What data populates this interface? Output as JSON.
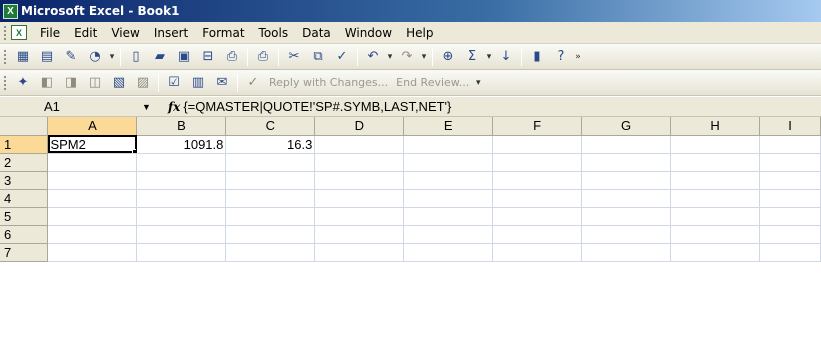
{
  "window": {
    "title": "Microsoft Excel - Book1",
    "app_icon": "X",
    "accent": "#0a246a"
  },
  "menu": {
    "doc_icon": "X",
    "items": [
      "File",
      "Edit",
      "View",
      "Insert",
      "Format",
      "Tools",
      "Data",
      "Window",
      "Help"
    ]
  },
  "toolbar1": {
    "icons": [
      "toolbar-a-icon",
      "toolbar-b-icon",
      "toolbar-c-icon",
      "toolbar-d-icon",
      "new-icon",
      "open-icon",
      "save-icon",
      "permission-icon",
      "print-preview-icon",
      "print-icon",
      "cut-icon",
      "copy-icon",
      "format-painter-icon",
      "undo-icon",
      "redo-icon",
      "hyperlink-icon",
      "autosum-icon",
      "sort-ascending-icon",
      "chart-icon",
      "help-icon",
      "overflow-icon"
    ]
  },
  "toolbar2": {
    "reply_label": "Reply with Changes...",
    "end_review_label": "End Review..."
  },
  "formula_bar": {
    "name_box": "A1",
    "fx_label": "fx",
    "formula": "{=QMASTER|QUOTE!'SP#.SYMB,LAST,NET'}"
  },
  "sheet": {
    "columns": [
      "A",
      "B",
      "C",
      "D",
      "E",
      "F",
      "G",
      "H",
      "I"
    ],
    "rows": [
      {
        "num": "1",
        "cells": [
          "SPM2",
          "1091.8",
          "16.3",
          "",
          "",
          "",
          "",
          "",
          ""
        ]
      },
      {
        "num": "2",
        "cells": [
          "",
          "",
          "",
          "",
          "",
          "",
          "",
          "",
          ""
        ]
      },
      {
        "num": "3",
        "cells": [
          "",
          "",
          "",
          "",
          "",
          "",
          "",
          "",
          ""
        ]
      },
      {
        "num": "4",
        "cells": [
          "",
          "",
          "",
          "",
          "",
          "",
          "",
          "",
          ""
        ]
      },
      {
        "num": "5",
        "cells": [
          "",
          "",
          "",
          "",
          "",
          "",
          "",
          "",
          ""
        ]
      },
      {
        "num": "6",
        "cells": [
          "",
          "",
          "",
          "",
          "",
          "",
          "",
          "",
          ""
        ]
      },
      {
        "num": "7",
        "cells": [
          "",
          "",
          "",
          "",
          "",
          "",
          "",
          "",
          ""
        ]
      }
    ],
    "selected_cell": "A1"
  }
}
